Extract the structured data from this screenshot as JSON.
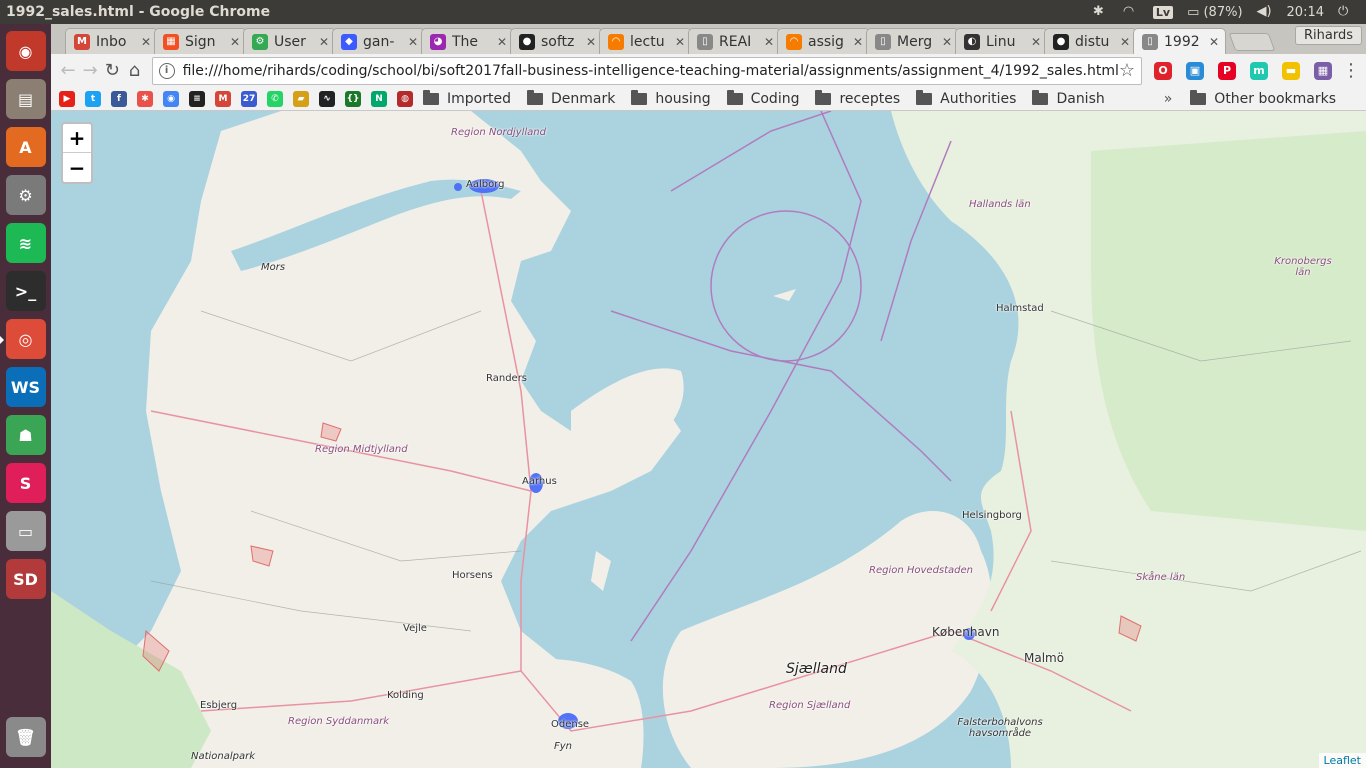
{
  "window": {
    "title": "1992_sales.html - Google Chrome"
  },
  "panel": {
    "keyboard": "Lv",
    "battery": "(87%)",
    "clock": "20:14"
  },
  "launcher": {
    "items": [
      {
        "name": "ubuntu-dash-icon",
        "glyph": "◉",
        "color": "#c0392b"
      },
      {
        "name": "files-icon",
        "glyph": "▤",
        "color": "#8a7f72"
      },
      {
        "name": "software-center-icon",
        "glyph": "A",
        "color": "#e26a21"
      },
      {
        "name": "system-settings-icon",
        "glyph": "⚙",
        "color": "#7a7a7a"
      },
      {
        "name": "spotify-icon",
        "glyph": "≋",
        "color": "#1db954"
      },
      {
        "name": "terminal-icon",
        "glyph": ">_",
        "color": "#2d2d2d"
      },
      {
        "name": "chrome-icon",
        "glyph": "◎",
        "color": "#dd4b39"
      },
      {
        "name": "webstorm-icon",
        "glyph": "WS",
        "color": "#0a6fb8"
      },
      {
        "name": "turtle-icon",
        "glyph": "☗",
        "color": "#3aa655"
      },
      {
        "name": "slack-icon",
        "glyph": "S",
        "color": "#e01e5a"
      },
      {
        "name": "drive-icon",
        "glyph": "▭",
        "color": "#9a9a9a"
      },
      {
        "name": "sd-card-icon",
        "glyph": "SD",
        "color": "#b23a3a"
      }
    ],
    "trash": {
      "name": "trash-icon",
      "glyph": "🗑",
      "color": "#8a8a8a"
    }
  },
  "tabs": [
    {
      "label": "Inbo",
      "fav": "M",
      "color": "#d44638"
    },
    {
      "label": "Sign",
      "fav": "▦",
      "color": "#f25022"
    },
    {
      "label": "User",
      "fav": "⚙",
      "color": "#34a853"
    },
    {
      "label": "gan-",
      "fav": "◆",
      "color": "#3d5afe"
    },
    {
      "label": "The ",
      "fav": "◕",
      "color": "#9c27b0"
    },
    {
      "label": "softz",
      "fav": "●",
      "color": "#222222"
    },
    {
      "label": "lectu",
      "fav": "◠",
      "color": "#f57c00"
    },
    {
      "label": "REAI",
      "fav": "▯",
      "color": "#888888"
    },
    {
      "label": "assig",
      "fav": "◠",
      "color": "#f57c00"
    },
    {
      "label": "Merg",
      "fav": "▯",
      "color": "#888888"
    },
    {
      "label": "Linu",
      "fav": "◐",
      "color": "#333333"
    },
    {
      "label": "distu",
      "fav": "●",
      "color": "#222222"
    },
    {
      "label": "1992",
      "fav": "▯",
      "color": "#888888",
      "active": true
    }
  ],
  "profile": "Rihards",
  "omnibox": {
    "url": "file:///home/rihards/coding/school/bi/soft2017fall-business-intelligence-teaching-material/assignments/assignment_4/1992_sales.html"
  },
  "extensions": [
    {
      "name": "opera-ext-icon",
      "glyph": "O",
      "color": "#e0232b"
    },
    {
      "name": "window-ext-icon",
      "glyph": "▣",
      "color": "#2a8bd6"
    },
    {
      "name": "pinterest-ext-icon",
      "glyph": "P",
      "color": "#e60023"
    },
    {
      "name": "m-ext-icon",
      "glyph": "m",
      "color": "#21c8b0"
    },
    {
      "name": "notes-ext-icon",
      "glyph": "▬",
      "color": "#f2c200"
    },
    {
      "name": "grid-ext-icon",
      "glyph": "▦",
      "color": "#7b5ea7"
    }
  ],
  "bookmarks": {
    "icons": [
      {
        "name": "youtube-icon",
        "glyph": "▶",
        "color": "#e62117"
      },
      {
        "name": "twitter-icon",
        "glyph": "t",
        "color": "#1da1f2"
      },
      {
        "name": "facebook-icon",
        "glyph": "f",
        "color": "#3b5998"
      },
      {
        "name": "asterisk-icon",
        "glyph": "✱",
        "color": "#e8524a"
      },
      {
        "name": "maps-pin-icon",
        "glyph": "◉",
        "color": "#4285f4"
      },
      {
        "name": "stack-icon",
        "glyph": "≡",
        "color": "#222222"
      },
      {
        "name": "gmail-icon",
        "glyph": "M",
        "color": "#d44638"
      },
      {
        "name": "calendar-icon",
        "glyph": "27",
        "color": "#3b5ccf"
      },
      {
        "name": "whatsapp-icon",
        "glyph": "✆",
        "color": "#25d366"
      },
      {
        "name": "car-icon",
        "glyph": "▰",
        "color": "#d4a017"
      },
      {
        "name": "wave-icon",
        "glyph": "∿",
        "color": "#222222"
      },
      {
        "name": "code-icon",
        "glyph": "{}",
        "color": "#1b7a2a"
      },
      {
        "name": "n-icon",
        "glyph": "N",
        "color": "#00a86b"
      },
      {
        "name": "globe-icon",
        "glyph": "◍",
        "color": "#b52a2a"
      }
    ],
    "folders": [
      "Imported",
      "Denmark",
      "housing",
      "Coding",
      "receptes",
      "Authorities",
      "Danish"
    ],
    "overflow": "»",
    "other": "Other bookmarks"
  },
  "map": {
    "zoom_in": "+",
    "zoom_out": "−",
    "attribution": "Leaflet",
    "labels": {
      "nordjylland": "Region Nordjylland",
      "aalborg": "Aalborg",
      "mors": "Mors",
      "randers": "Randers",
      "midtjylland": "Region Midtjylland",
      "aarhus": "Aarhus",
      "horsens": "Horsens",
      "vejle": "Vejle",
      "kolding": "Kolding",
      "esbjerg": "Esbjerg",
      "syddanmark": "Region Syddanmark",
      "odense": "Odense",
      "fyn": "Fyn",
      "nationalpark": "Nationalpark",
      "sjaelland": "Sjælland",
      "region_sjaelland": "Region Sjælland",
      "hovedstaden": "Region Hovedstaden",
      "kobenhavn": "København",
      "helsingborg": "Helsingborg",
      "malmo": "Malmö",
      "skane": "Skåne län",
      "falsterbo": "Falsterbohalvons havsområde",
      "halland": "Hallands län",
      "halmstad": "Halmstad",
      "kronoberg": "Kronobergs län"
    }
  }
}
